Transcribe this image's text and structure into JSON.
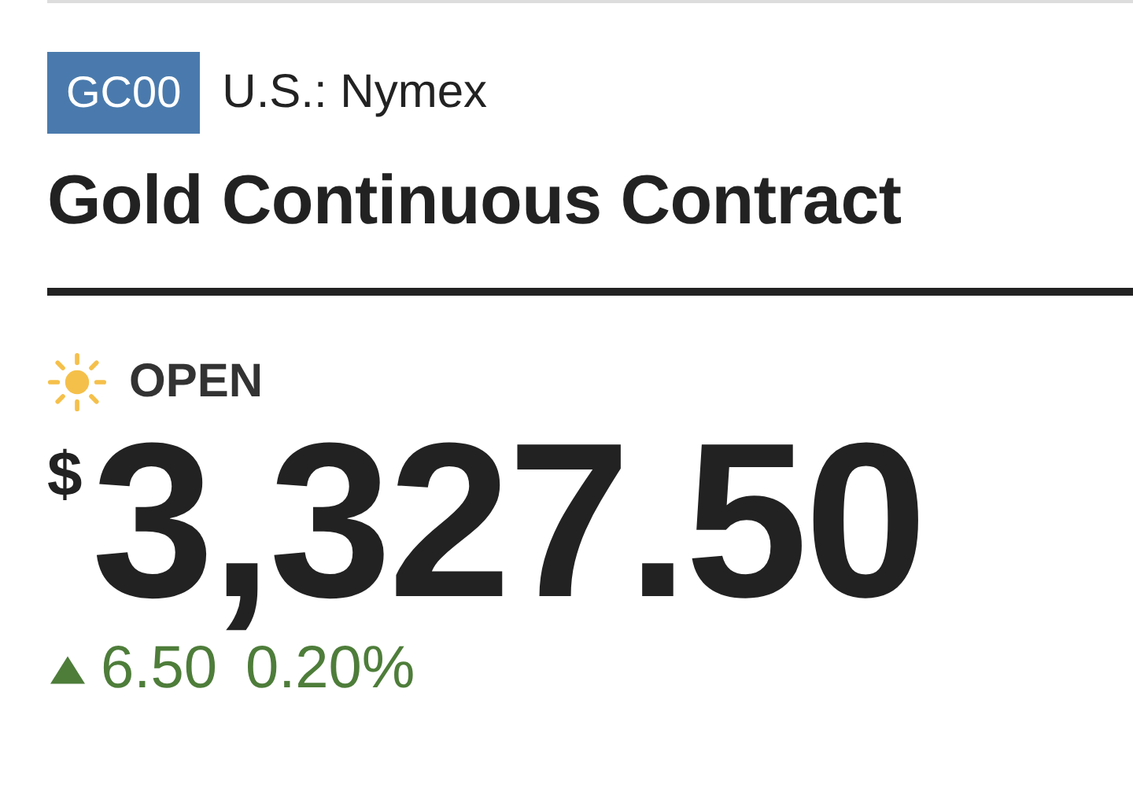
{
  "symbol": "GC00",
  "exchange": "U.S.: Nymex",
  "title": "Gold Continuous Contract",
  "market_status": {
    "open": true,
    "label": "OPEN"
  },
  "price": {
    "currency": "$",
    "value": "3,327.50"
  },
  "change": {
    "up": true,
    "amount": "6.50",
    "percent": "0.20%"
  }
}
